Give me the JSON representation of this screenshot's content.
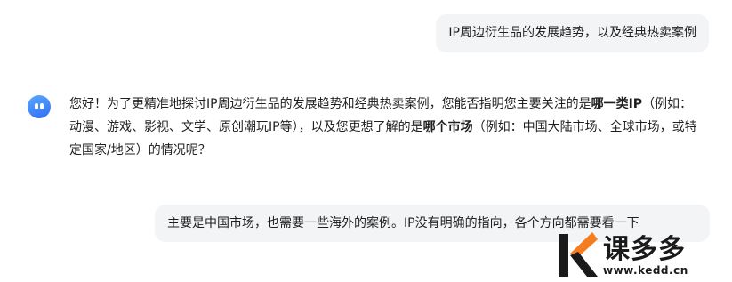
{
  "messages": {
    "user_1": "IP周边衍生品的发展趋势，以及经典热卖案例",
    "assistant": {
      "part_1": "您好！为了更精准地探讨IP周边衍生品的发展趋势和经典热卖案例，您能否指明您主要关注的是",
      "bold_1": "哪一类IP",
      "part_2": "（例如：动漫、游戏、影视、文学、原创潮玩IP等），以及您更想了解的是",
      "bold_2": "哪个市场",
      "part_3": "（例如：中国大陆市场、全球市场，或特定国家/地区）的情况呢？"
    },
    "user_2": "主要是中国市场，也需要一些海外的案例。IP没有明确的指向，各个方向都需要看一下"
  },
  "watermark": {
    "brand": "课多多",
    "url": "www.kedd.cn",
    "icon": "k-logo-icon",
    "accent_color": "#f57c1f"
  },
  "avatar_icon": "assistant-avatar-icon",
  "colors": {
    "bubble_bg": "#f3f4f6",
    "avatar_blue": "#2f6df6",
    "text": "#1f1f1f"
  }
}
